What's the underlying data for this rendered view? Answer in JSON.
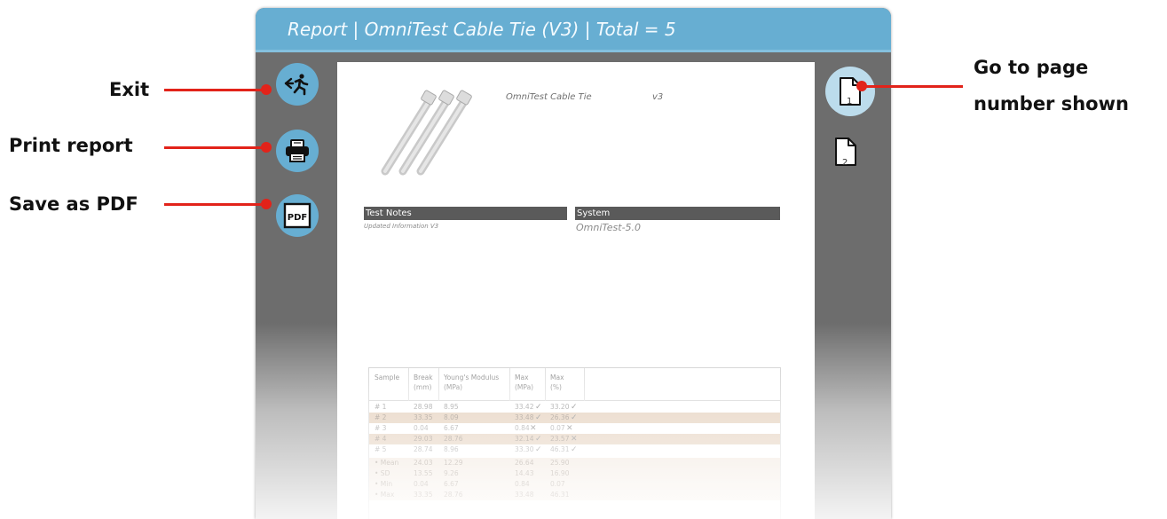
{
  "window": {
    "title": "Report | OmniTest Cable Tie (V3) | Total = 5"
  },
  "rail": {
    "exit_icon": "exit-running-person-icon",
    "print_icon": "printer-icon",
    "pdf_icon": "pdf-icon",
    "pdf_label": "PDF"
  },
  "pages": [
    {
      "number": "1",
      "current": true
    },
    {
      "number": "2",
      "current": false
    }
  ],
  "report": {
    "product_name": "OmniTest Cable Tie",
    "product_version": "v3",
    "test_notes_heading": "Test Notes",
    "test_notes_text": "Updated Information V3",
    "system_heading": "System",
    "system_text": "OmniTest-5.0",
    "table": {
      "headers": [
        "Sample",
        "Break",
        "(mm)",
        "Young's Modulus",
        "(MPa)",
        "Max",
        "(MPa)",
        "Max",
        "(%)"
      ],
      "rows": [
        {
          "sample": "# 1",
          "break": "28.98",
          "modulus": "8.95",
          "max_mpa": "33.42",
          "max_mpa_mark": "✓",
          "max_pct": "33.20",
          "max_pct_mark": "✓"
        },
        {
          "sample": "# 2",
          "break": "33.35",
          "modulus": "8.09",
          "max_mpa": "33.48",
          "max_mpa_mark": "✓",
          "max_pct": "26.36",
          "max_pct_mark": "✓"
        },
        {
          "sample": "# 3",
          "break": "0.04",
          "modulus": "6.67",
          "max_mpa": "0.84",
          "max_mpa_mark": "✕",
          "max_pct": "0.07",
          "max_pct_mark": "✕"
        },
        {
          "sample": "# 4",
          "break": "29.03",
          "modulus": "28.76",
          "max_mpa": "32.14",
          "max_mpa_mark": "✓",
          "max_pct": "23.57",
          "max_pct_mark": "✕"
        },
        {
          "sample": "# 5",
          "break": "28.74",
          "modulus": "8.96",
          "max_mpa": "33.30",
          "max_mpa_mark": "✓",
          "max_pct": "46.31",
          "max_pct_mark": "✓"
        }
      ],
      "stats": [
        {
          "label": "• Mean",
          "break": "24.03",
          "modulus": "12.29",
          "max_mpa": "26.64",
          "max_pct": "25.90"
        },
        {
          "label": "• SD",
          "break": "13.55",
          "modulus": "9.26",
          "max_mpa": "14.43",
          "max_pct": "16.90"
        },
        {
          "label": "• Min",
          "break": "0.04",
          "modulus": "6.67",
          "max_mpa": "0.84",
          "max_pct": "0.07"
        },
        {
          "label": "• Max",
          "break": "33.35",
          "modulus": "28.76",
          "max_mpa": "33.48",
          "max_pct": "46.31"
        }
      ]
    }
  },
  "callouts": {
    "exit": "Exit",
    "print": "Print report",
    "pdf": "Save as PDF",
    "goto_line1": "Go to page",
    "goto_line2": "number shown"
  },
  "colors": {
    "title_bar": "#67aed2",
    "window_bg": "#6d6d6d",
    "callout": "#e2231a",
    "row_highlight": "#d7b89a"
  }
}
